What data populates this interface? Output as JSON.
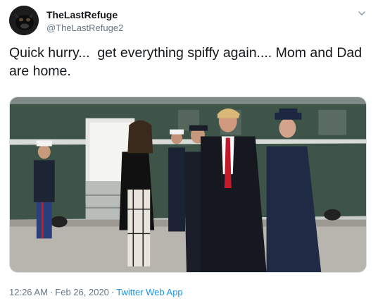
{
  "author": {
    "display_name": "TheLastRefuge",
    "handle": "@TheLastRefuge2",
    "avatar_icon": "avatar-image"
  },
  "tweet": {
    "text": "Quick hurry...  get everything spiffy again.... Mom and Dad are home."
  },
  "media": {
    "type": "photo",
    "description_icon": "photo-image"
  },
  "meta": {
    "time": "12:26 AM",
    "separator": "·",
    "date": "Feb 26, 2020",
    "source": "Twitter Web App"
  },
  "icons": {
    "caret": "chevron-down-icon"
  },
  "colors": {
    "link": "#1b95e0",
    "secondary_text": "#657786",
    "primary_text": "#14171a"
  }
}
